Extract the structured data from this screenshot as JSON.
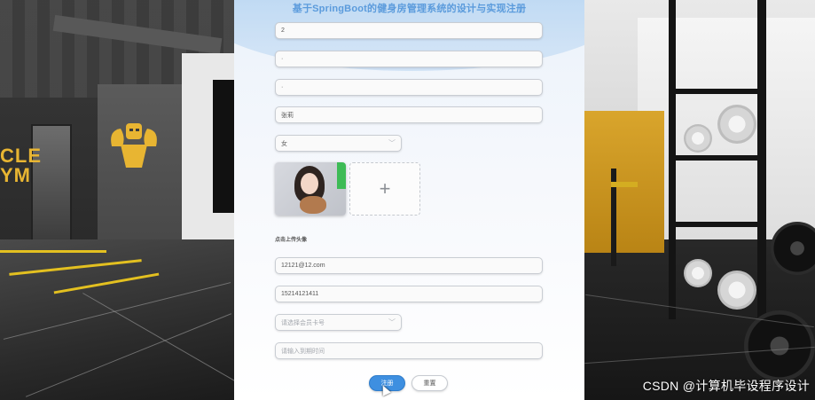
{
  "page_title": "基于SpringBoot的健身房管理系统的设计与实现注册",
  "form": {
    "account": {
      "value": "2"
    },
    "password": {
      "value": "·"
    },
    "confirm_password": {
      "value": "·"
    },
    "name": {
      "value": "张莉"
    },
    "gender": {
      "value": "女"
    },
    "avatar": {
      "upload_label": "点击上传头像",
      "add_symbol": "+"
    },
    "email": {
      "value": "12121@12.com"
    },
    "phone": {
      "value": "15214121411"
    },
    "member_card": {
      "placeholder": "请选择会员卡号"
    },
    "expiry_time": {
      "placeholder": "请输入到期时间"
    }
  },
  "buttons": {
    "register": "注册",
    "reset": "重置"
  },
  "background": {
    "sign_text_1": "CLE",
    "sign_text_2": "YM"
  },
  "watermark": "CSDN @计算机毕设程序设计",
  "colors": {
    "primary": "#3e8fe0",
    "title": "#5b9bdc",
    "gym_yellow": "#e8b532"
  }
}
